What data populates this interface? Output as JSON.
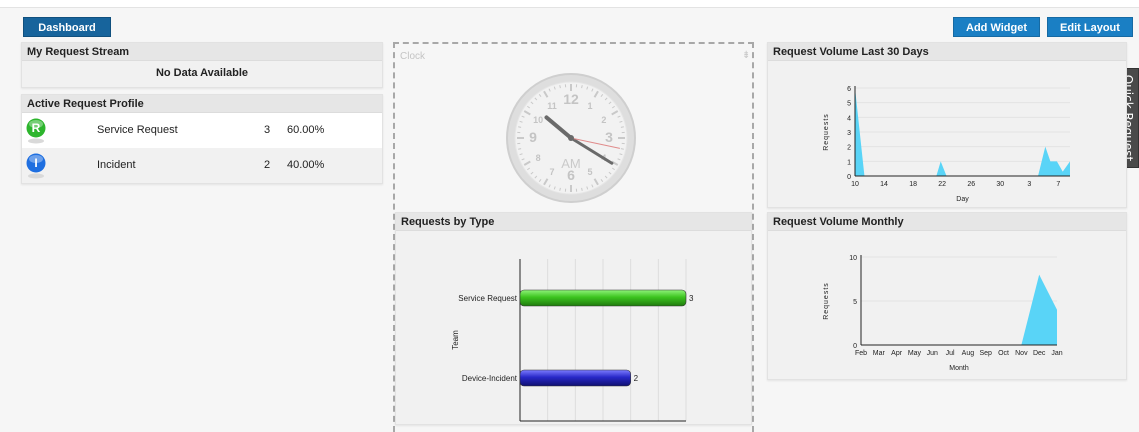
{
  "toolbar": {
    "dashboard_label": "Dashboard",
    "add_widget_label": "Add Widget",
    "edit_layout_label": "Edit Layout"
  },
  "quick_request": {
    "label": "Quick Request"
  },
  "stream": {
    "title": "My Request Stream",
    "empty_text": "No Data Available"
  },
  "profile": {
    "title": "Active Request Profile",
    "rows": [
      {
        "icon": "R",
        "icon_color": "#2db52d",
        "name": "Service Request",
        "count": "3",
        "percent": "60.00%"
      },
      {
        "icon": "I",
        "icon_color": "#1f6fe0",
        "name": "Incident",
        "count": "2",
        "percent": "40.00%"
      }
    ]
  },
  "clock": {
    "title": "Clock",
    "numbers": [
      "12",
      "1",
      "2",
      "3",
      "4",
      "5",
      "6",
      "7",
      "8",
      "9",
      "10",
      "11"
    ],
    "ampm": "AM",
    "time": {
      "hours": 10,
      "minutes": 20,
      "seconds": 17
    }
  },
  "colors": {
    "accent": "#1a7fc4",
    "area": "#59d4f7",
    "bar_green": "#3cc41e",
    "bar_blue": "#2828c8"
  },
  "chart_data": [
    {
      "type": "bar",
      "orientation": "horizontal",
      "title": "Requests by Type",
      "ylabel": "Team",
      "categories": [
        "Service Request",
        "Device-Incident"
      ],
      "values": [
        3,
        2
      ],
      "xlim": [
        0,
        3
      ],
      "xticks": [
        "0",
        "0.5",
        "1",
        "1.5",
        "2",
        "2.5",
        "3"
      ]
    },
    {
      "type": "area",
      "title": "Request Volume Last 30 Days",
      "xlabel": "Day",
      "ylabel": "Requests",
      "x_ticks": [
        "10",
        "14",
        "18",
        "22",
        "26",
        "30",
        "3",
        "7"
      ],
      "ylim": [
        0,
        6
      ],
      "y_ticks": [
        "0",
        "1",
        "2",
        "3",
        "4",
        "5",
        "6"
      ],
      "points": [
        [
          0,
          6
        ],
        [
          1.3,
          0
        ],
        [
          11.2,
          0
        ],
        [
          11.8,
          1
        ],
        [
          12.6,
          0
        ],
        [
          25.2,
          0
        ],
        [
          26.2,
          2
        ],
        [
          26.9,
          1
        ],
        [
          27.8,
          1
        ],
        [
          28.6,
          0.3
        ],
        [
          29.6,
          1
        ],
        [
          29.6,
          0
        ]
      ]
    },
    {
      "type": "area",
      "title": "Request Volume Monthly",
      "xlabel": "Month",
      "ylabel": "Requests",
      "categories": [
        "Feb",
        "Mar",
        "Apr",
        "May",
        "Jun",
        "Jul",
        "Aug",
        "Sep",
        "Oct",
        "Nov",
        "Dec",
        "Jan"
      ],
      "values": [
        0,
        0,
        0,
        0,
        0,
        0,
        0,
        0,
        0,
        0,
        8,
        4
      ],
      "ylim": [
        0,
        10
      ],
      "y_ticks": [
        "0",
        "5",
        "10"
      ]
    }
  ]
}
